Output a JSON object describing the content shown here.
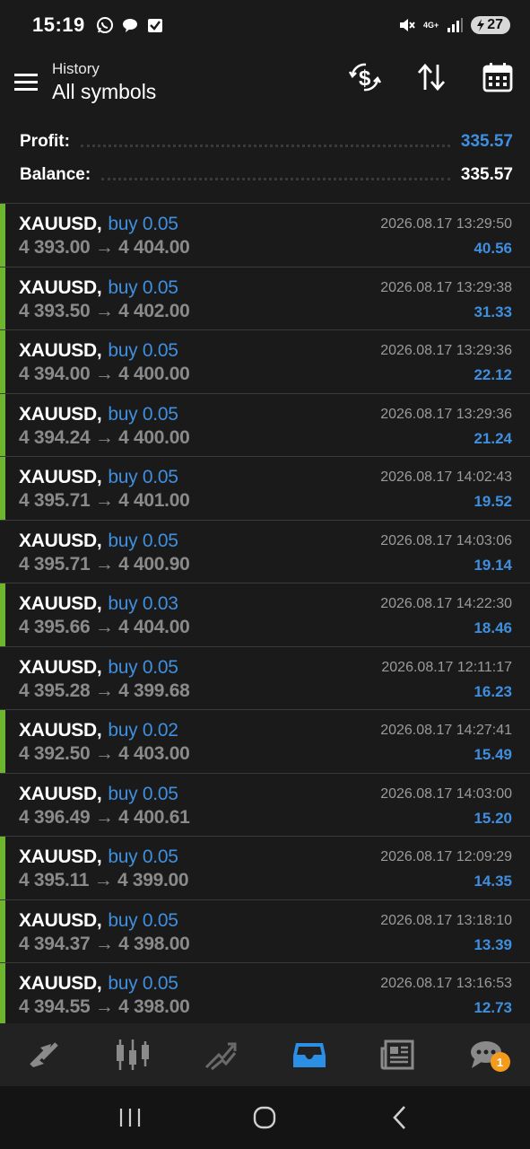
{
  "status_bar": {
    "time": "15:19",
    "battery": "27",
    "network": "4G+"
  },
  "header": {
    "title_small": "History",
    "title_large": "All symbols"
  },
  "summary": {
    "profit_label": "Profit:",
    "profit_value": "335.57",
    "balance_label": "Balance:",
    "balance_value": "335.57"
  },
  "trades": [
    {
      "symbol": "XAUUSD,",
      "side": "buy 0.05",
      "prices": "4 393.00 → 4 404.00",
      "datetime": "2026.08.17 13:29:50",
      "profit": "40.56",
      "marker": true
    },
    {
      "symbol": "XAUUSD,",
      "side": "buy 0.05",
      "prices": "4 393.50 → 4 402.00",
      "datetime": "2026.08.17 13:29:38",
      "profit": "31.33",
      "marker": true
    },
    {
      "symbol": "XAUUSD,",
      "side": "buy 0.05",
      "prices": "4 394.00 → 4 400.00",
      "datetime": "2026.08.17 13:29:36",
      "profit": "22.12",
      "marker": true
    },
    {
      "symbol": "XAUUSD,",
      "side": "buy 0.05",
      "prices": "4 394.24 → 4 400.00",
      "datetime": "2026.08.17 13:29:36",
      "profit": "21.24",
      "marker": true
    },
    {
      "symbol": "XAUUSD,",
      "side": "buy 0.05",
      "prices": "4 395.71 → 4 401.00",
      "datetime": "2026.08.17 14:02:43",
      "profit": "19.52",
      "marker": true
    },
    {
      "symbol": "XAUUSD,",
      "side": "buy 0.05",
      "prices": "4 395.71 → 4 400.90",
      "datetime": "2026.08.17 14:03:06",
      "profit": "19.14",
      "marker": false
    },
    {
      "symbol": "XAUUSD,",
      "side": "buy 0.03",
      "prices": "4 395.66 → 4 404.00",
      "datetime": "2026.08.17 14:22:30",
      "profit": "18.46",
      "marker": true
    },
    {
      "symbol": "XAUUSD,",
      "side": "buy 0.05",
      "prices": "4 395.28 → 4 399.68",
      "datetime": "2026.08.17 12:11:17",
      "profit": "16.23",
      "marker": false
    },
    {
      "symbol": "XAUUSD,",
      "side": "buy 0.02",
      "prices": "4 392.50 → 4 403.00",
      "datetime": "2026.08.17 14:27:41",
      "profit": "15.49",
      "marker": true
    },
    {
      "symbol": "XAUUSD,",
      "side": "buy 0.05",
      "prices": "4 396.49 → 4 400.61",
      "datetime": "2026.08.17 14:03:00",
      "profit": "15.20",
      "marker": false
    },
    {
      "symbol": "XAUUSD,",
      "side": "buy 0.05",
      "prices": "4 395.11 → 4 399.00",
      "datetime": "2026.08.17 12:09:29",
      "profit": "14.35",
      "marker": true
    },
    {
      "symbol": "XAUUSD,",
      "side": "buy 0.05",
      "prices": "4 394.37 → 4 398.00",
      "datetime": "2026.08.17 13:18:10",
      "profit": "13.39",
      "marker": true
    },
    {
      "symbol": "XAUUSD,",
      "side": "buy 0.05",
      "prices": "4 394.55 → 4 398.00",
      "datetime": "2026.08.17 13:16:53",
      "profit": "12.73",
      "marker": true
    }
  ],
  "bottom_nav": {
    "items": [
      "quotes-icon",
      "chart-icon",
      "trade-icon",
      "history-icon",
      "news-icon",
      "messages-icon"
    ],
    "active": "history-icon",
    "messages_badge": "1"
  },
  "colors": {
    "accent": "#3f8fe0",
    "profit_marker": "#6eb52f",
    "badge": "#f59b1c",
    "background": "#1a1a1a"
  }
}
